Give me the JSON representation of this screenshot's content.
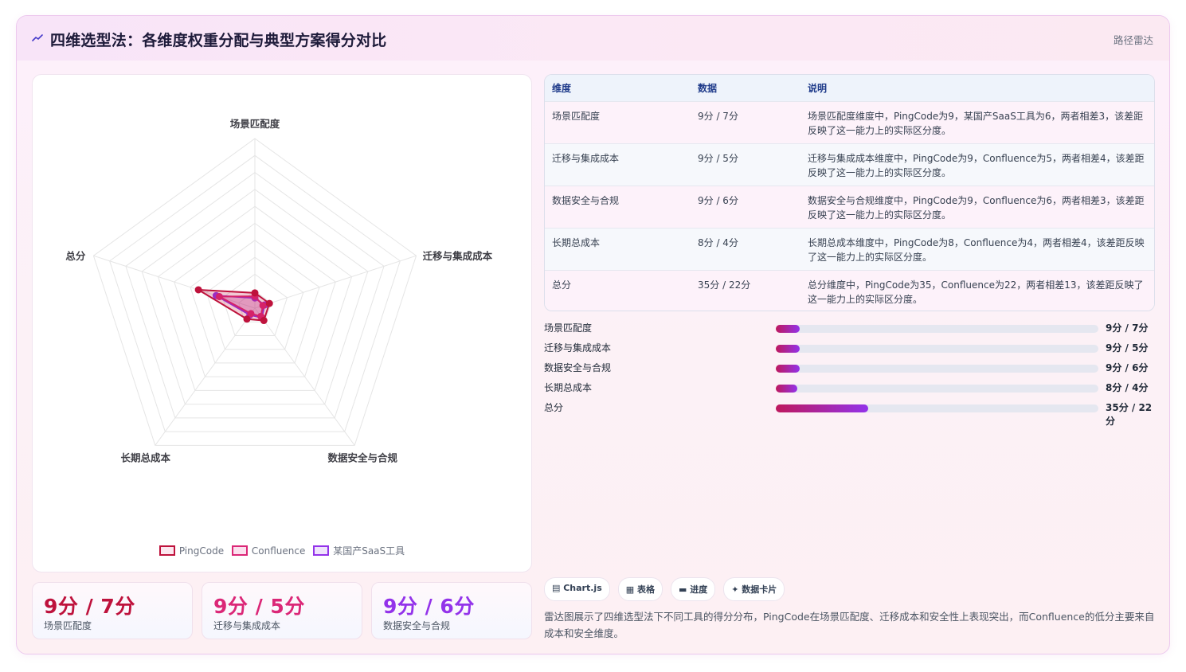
{
  "header": {
    "title": "四维选型法：各维度权重分配与典型方案得分对比",
    "tag": "路径雷达"
  },
  "chart_data": {
    "type": "radar",
    "axes": [
      "场景匹配度",
      "迁移与集成成本",
      "数据安全与合规",
      "长期总成本",
      "总分"
    ],
    "r_max": 100,
    "series": [
      {
        "name": "PingCode",
        "values": [
          9,
          9,
          9,
          8,
          35
        ],
        "color": "#be123c"
      },
      {
        "name": "Confluence",
        "values": [
          7,
          5,
          6,
          4,
          22
        ],
        "color": "#db2777"
      },
      {
        "name": "某国产SaaS工具",
        "values": [
          6,
          6,
          7,
          5,
          24
        ],
        "color": "#9333ea"
      }
    ],
    "legend_position": "bottom"
  },
  "stats": [
    {
      "value": "9分 / 7分",
      "label": "场景匹配度",
      "color": "#be123c"
    },
    {
      "value": "9分 / 5分",
      "label": "迁移与集成成本",
      "color": "#db2777"
    },
    {
      "value": "9分 / 6分",
      "label": "数据安全与合规",
      "color": "#9333ea"
    }
  ],
  "table": {
    "headers": [
      "维度",
      "数据",
      "说明"
    ],
    "rows": [
      [
        "场景匹配度",
        "9分 / 7分",
        "场景匹配度维度中，PingCode为9，某国产SaaS工具为6，两者相差3，该差距反映了这一能力上的实际区分度。"
      ],
      [
        "迁移与集成成本",
        "9分 / 5分",
        "迁移与集成成本维度中，PingCode为9，Confluence为5，两者相差4，该差距反映了这一能力上的实际区分度。"
      ],
      [
        "数据安全与合规",
        "9分 / 6分",
        "数据安全与合规维度中，PingCode为9，Confluence为6，两者相差3，该差距反映了这一能力上的实际区分度。"
      ],
      [
        "长期总成本",
        "8分 / 4分",
        "长期总成本维度中，PingCode为8，Confluence为4，两者相差4，该差距反映了这一能力上的实际区分度。"
      ],
      [
        "总分",
        "35分 / 22分",
        "总分维度中，PingCode为35，Confluence为22，两者相差13，该差距反映了这一能力上的实际区分度。"
      ]
    ]
  },
  "bars": [
    {
      "label": "场景匹配度",
      "value": "9分 / 7分",
      "fraction": 0.074
    },
    {
      "label": "迁移与集成成本",
      "value": "9分 / 5分",
      "fraction": 0.074
    },
    {
      "label": "数据安全与合规",
      "value": "9分 / 6分",
      "fraction": 0.074
    },
    {
      "label": "长期总成本",
      "value": "8分 / 4分",
      "fraction": 0.066
    },
    {
      "label": "总分",
      "value": "35分 / 22分",
      "fraction": 0.286
    }
  ],
  "chips": [
    "Chart.js",
    "表格",
    "进度",
    "数据卡片"
  ],
  "chip_icons": [
    "chart-icon",
    "table-icon",
    "progress-icon",
    "card-icon"
  ],
  "note": "雷达图展示了四维选型法下不同工具的得分分布，PingCode在场景匹配度、迁移成本和安全性上表现突出，而Confluence的低分主要来自成本和安全维度。"
}
